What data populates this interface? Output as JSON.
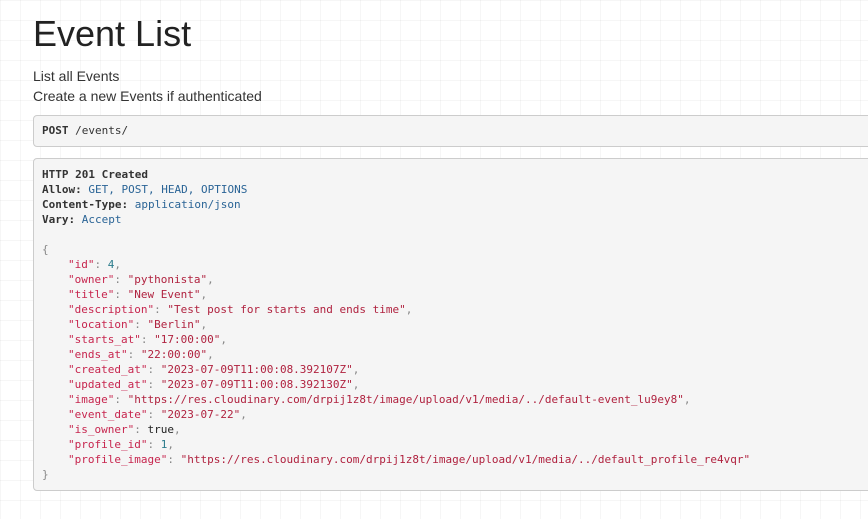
{
  "page": {
    "title": "Event List",
    "description": [
      "List all Events",
      "Create a new Events if authenticated"
    ]
  },
  "request": {
    "method": "POST",
    "path": "/events/"
  },
  "response": {
    "status": "HTTP 201 Created",
    "headers": [
      {
        "name": "Allow:",
        "value": "GET, POST, HEAD, OPTIONS"
      },
      {
        "name": "Content-Type:",
        "value": "application/json"
      },
      {
        "name": "Vary:",
        "value": "Accept"
      }
    ],
    "open_brace": "{",
    "close_brace": "}",
    "fields": [
      {
        "key": "\"id\"",
        "value": "4",
        "type": "num"
      },
      {
        "key": "\"owner\"",
        "value": "\"pythonista\"",
        "type": "str"
      },
      {
        "key": "\"title\"",
        "value": "\"New Event\"",
        "type": "str"
      },
      {
        "key": "\"description\"",
        "value": "\"Test post for starts and ends time\"",
        "type": "str"
      },
      {
        "key": "\"location\"",
        "value": "\"Berlin\"",
        "type": "str"
      },
      {
        "key": "\"starts_at\"",
        "value": "\"17:00:00\"",
        "type": "str"
      },
      {
        "key": "\"ends_at\"",
        "value": "\"22:00:00\"",
        "type": "str"
      },
      {
        "key": "\"created_at\"",
        "value": "\"2023-07-09T11:00:08.392107Z\"",
        "type": "str"
      },
      {
        "key": "\"updated_at\"",
        "value": "\"2023-07-09T11:00:08.392130Z\"",
        "type": "str"
      },
      {
        "key": "\"image\"",
        "value": "\"https://res.cloudinary.com/drpij1z8t/image/upload/v1/media/../default-event_lu9ey8\"",
        "type": "str"
      },
      {
        "key": "\"event_date\"",
        "value": "\"2023-07-22\"",
        "type": "str"
      },
      {
        "key": "\"is_owner\"",
        "value": "true",
        "type": "lit"
      },
      {
        "key": "\"profile_id\"",
        "value": "1",
        "type": "num"
      },
      {
        "key": "\"profile_image\"",
        "value": "\"https://res.cloudinary.com/drpij1z8t/image/upload/v1/media/../default_profile_re4vqr\"",
        "type": "str"
      }
    ]
  }
}
